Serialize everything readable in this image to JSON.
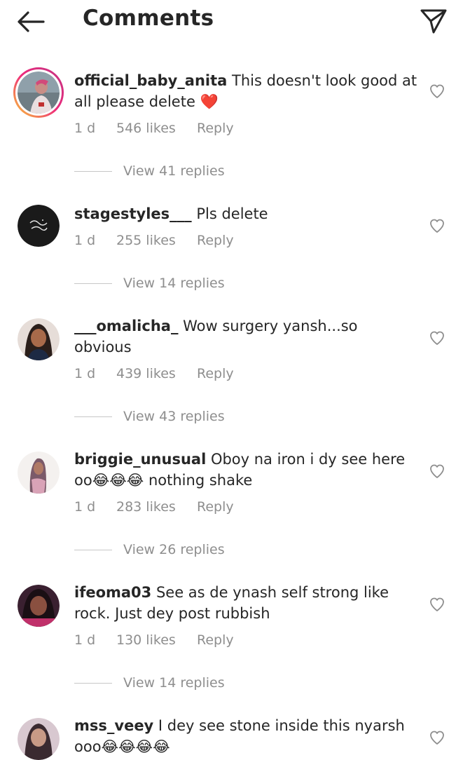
{
  "header": {
    "title": "Comments",
    "back_icon": "arrow-left-icon",
    "share_icon": "direct-send-icon"
  },
  "comments": [
    {
      "username": "official_baby_anita",
      "text": " This doesn't look good at all please delete ❤️",
      "time": "1 d",
      "likes": "546 likes",
      "reply": "Reply",
      "view_replies": "View 41 replies",
      "has_story_ring": true
    },
    {
      "username": "stagestyles___",
      "text": " Pls delete",
      "time": "1 d",
      "likes": "255 likes",
      "reply": "Reply",
      "view_replies": "View 14 replies",
      "has_story_ring": false
    },
    {
      "username": "___omalicha_",
      "text": " Wow surgery yansh...so obvious",
      "time": "1 d",
      "likes": "439 likes",
      "reply": "Reply",
      "view_replies": "View 43 replies",
      "has_story_ring": false
    },
    {
      "username": "briggie_unusual",
      "text": " Oboy na iron i dy see here oo😂😂😂 nothing shake",
      "time": "1 d",
      "likes": "283 likes",
      "reply": "Reply",
      "view_replies": "View 26 replies",
      "has_story_ring": false
    },
    {
      "username": "ifeoma03",
      "text": " See as de ynash self strong like rock. Just dey post rubbish",
      "time": "1 d",
      "likes": "130 likes",
      "reply": "Reply",
      "view_replies": "View 14 replies",
      "has_story_ring": false
    },
    {
      "username": "mss_veey",
      "text": " I dey see stone inside this nyarsh ooo😂😂😂😂",
      "has_story_ring": false
    }
  ],
  "colors": {
    "text": "#262626",
    "secondary": "#8e8e8e",
    "divider": "#c7c7c7",
    "heart_red": "#ed4956"
  }
}
